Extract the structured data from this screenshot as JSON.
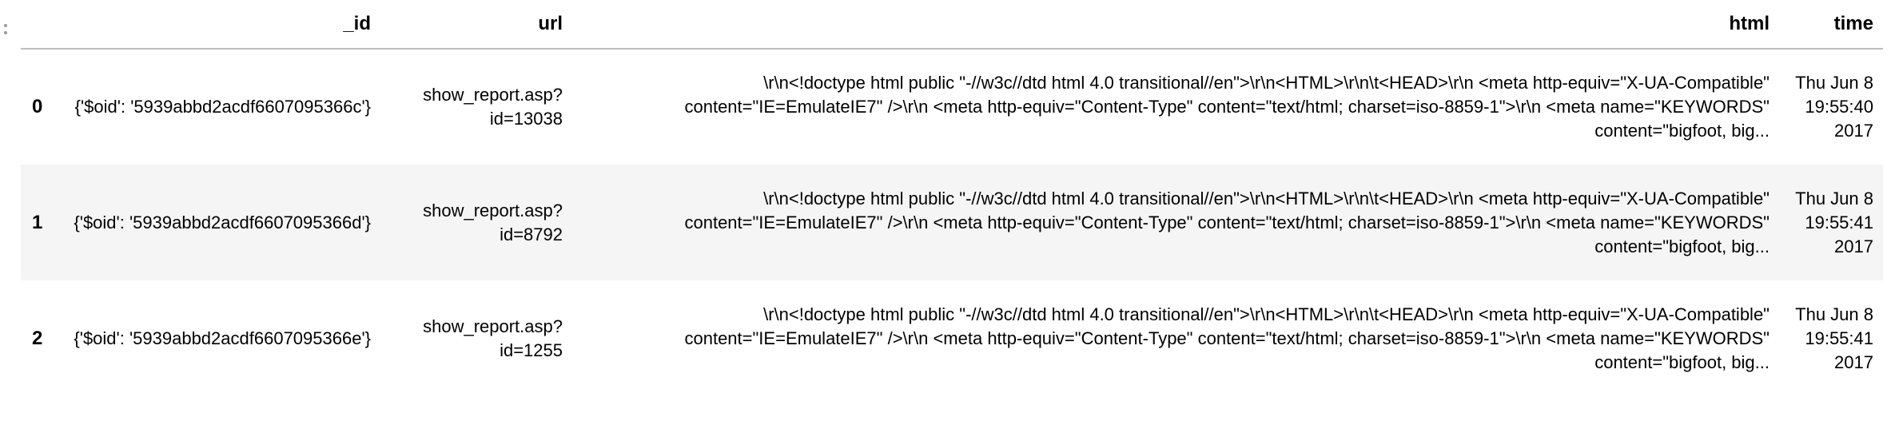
{
  "table": {
    "columns": [
      "",
      "_id",
      "url",
      "html",
      "time"
    ],
    "rows": [
      {
        "index": "0",
        "id": "{'$oid': '5939abbd2acdf6607095366c'}",
        "url": "show_report.asp?id=13038",
        "html": "\\r\\n<!doctype html public \"-//w3c//dtd html 4.0 transitional//en\">\\r\\n<HTML>\\r\\n\\t<HEAD>\\r\\n <meta http-equiv=\"X-UA-Compatible\" content=\"IE=EmulateIE7\" />\\r\\n <meta http-equiv=\"Content-Type\" content=\"text/html; charset=iso-8859-1\">\\r\\n <meta name=\"KEYWORDS\" content=\"bigfoot, big...",
        "time": "Thu Jun 8 19:55:40 2017"
      },
      {
        "index": "1",
        "id": "{'$oid': '5939abbd2acdf6607095366d'}",
        "url": "show_report.asp?id=8792",
        "html": "\\r\\n<!doctype html public \"-//w3c//dtd html 4.0 transitional//en\">\\r\\n<HTML>\\r\\n\\t<HEAD>\\r\\n <meta http-equiv=\"X-UA-Compatible\" content=\"IE=EmulateIE7\" />\\r\\n <meta http-equiv=\"Content-Type\" content=\"text/html; charset=iso-8859-1\">\\r\\n <meta name=\"KEYWORDS\" content=\"bigfoot, big...",
        "time": "Thu Jun 8 19:55:41 2017"
      },
      {
        "index": "2",
        "id": "{'$oid': '5939abbd2acdf6607095366e'}",
        "url": "show_report.asp?id=1255",
        "html": "\\r\\n<!doctype html public \"-//w3c//dtd html 4.0 transitional//en\">\\r\\n<HTML>\\r\\n\\t<HEAD>\\r\\n <meta http-equiv=\"X-UA-Compatible\" content=\"IE=EmulateIE7\" />\\r\\n <meta http-equiv=\"Content-Type\" content=\"text/html; charset=iso-8859-1\">\\r\\n <meta name=\"KEYWORDS\" content=\"bigfoot, big...",
        "time": "Thu Jun 8 19:55:41 2017"
      }
    ]
  },
  "icons": {
    "drag_handle": "drag-handle-icon"
  },
  "colors": {
    "stripe": "#f5f5f5",
    "header_rule": "#bdbdbd"
  }
}
